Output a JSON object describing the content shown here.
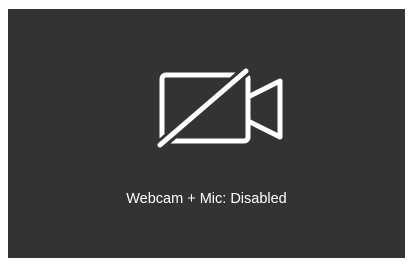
{
  "webcam_panel": {
    "status_text": "Webcam + Mic: Disabled",
    "icon": "camera-off-icon",
    "background_color": "#333333",
    "text_color": "#ffffff"
  }
}
